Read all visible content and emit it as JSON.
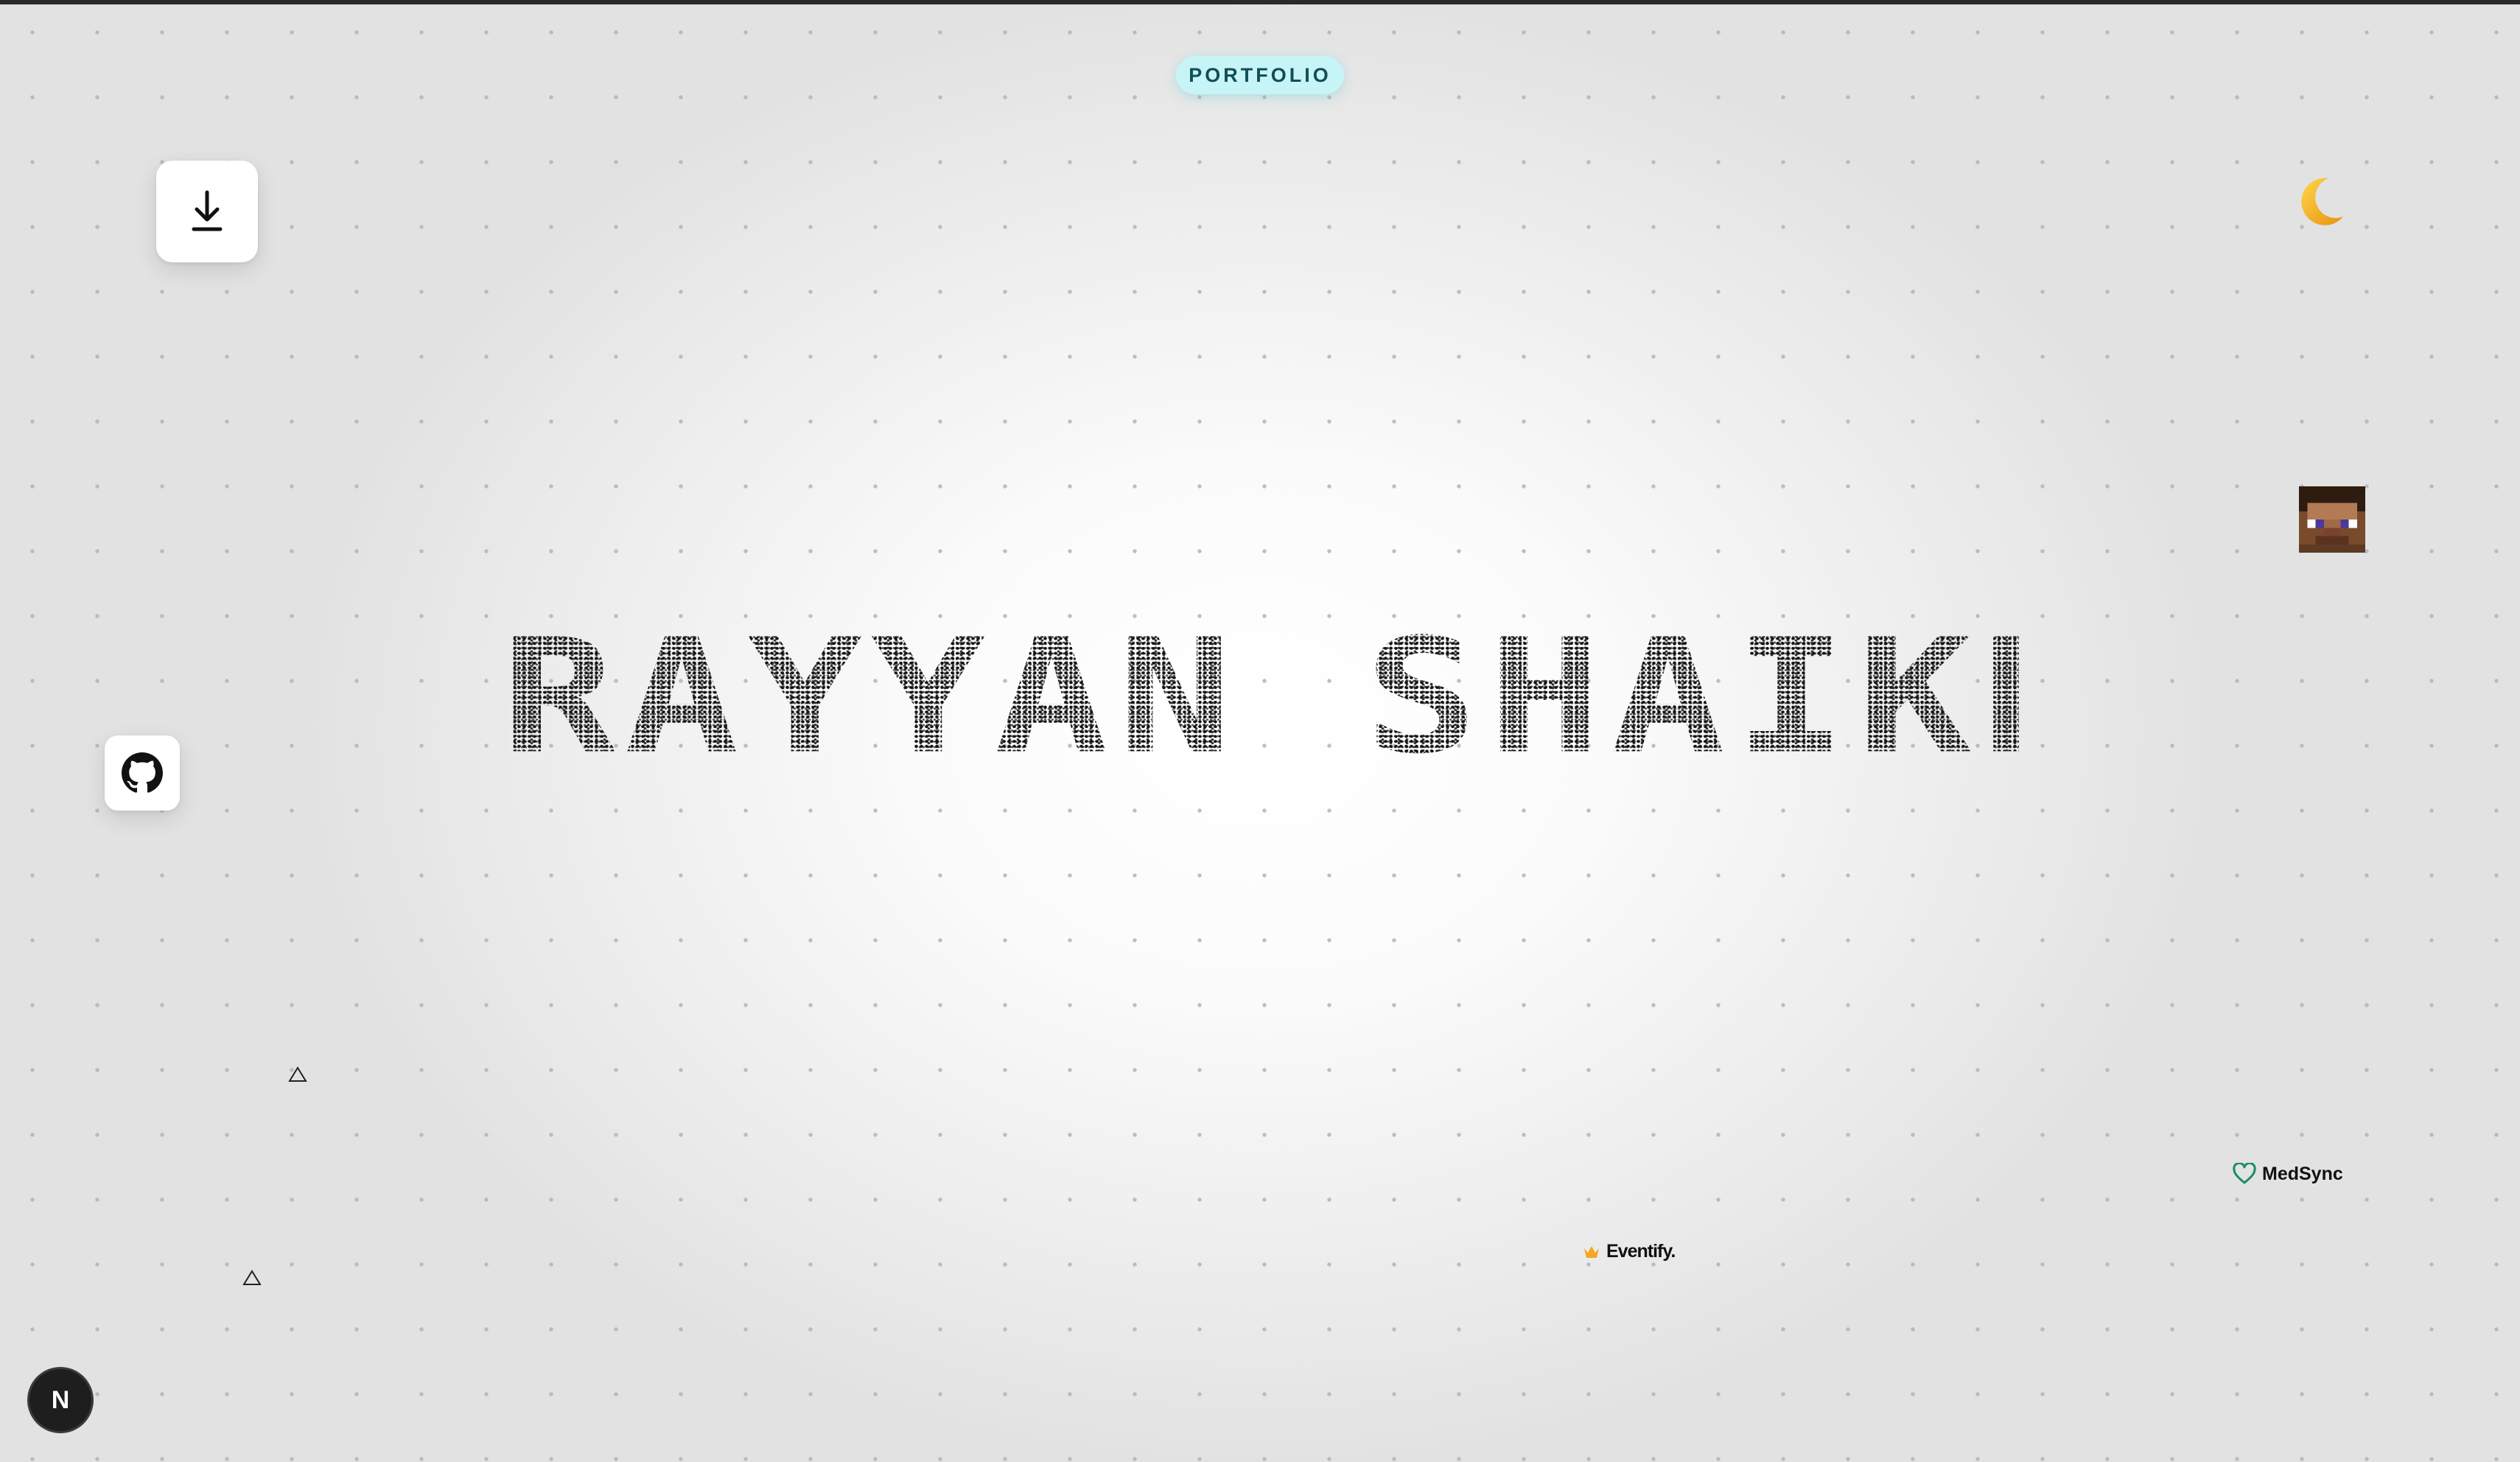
{
  "header": {
    "badge_label": "PORTFOLIO"
  },
  "hero": {
    "name": "RAYYAN SHAIKH"
  },
  "projects": [
    {
      "name": "Eventify.",
      "icon": "crown-icon",
      "accent": "#f5a623"
    },
    {
      "name": "MedSync",
      "icon": "heart-icon",
      "accent": "#1a8a6a"
    }
  ],
  "floating_icons": [
    "download-icon",
    "github-icon",
    "moon-icon",
    "avatar-icon",
    "triangle-icon",
    "triangle-icon"
  ],
  "footer": {
    "dev_badge_label": "N"
  },
  "colors": {
    "badge_bg": "#c7f4f6",
    "badge_text": "#0f4f57",
    "moon": "#f2a81d",
    "text": "#111111"
  }
}
